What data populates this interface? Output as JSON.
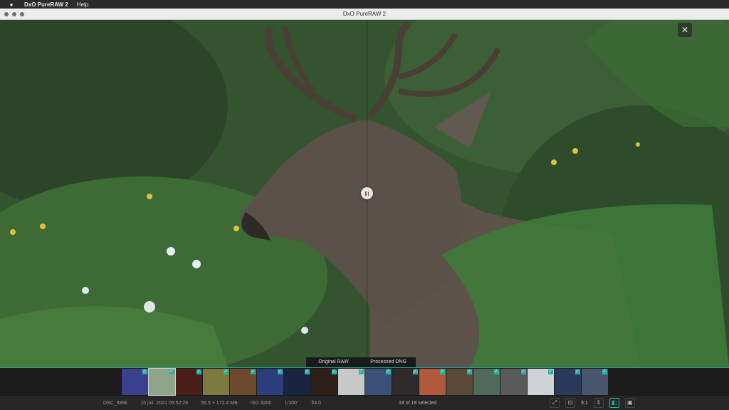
{
  "menubar": {
    "app_name": "DxO PureRAW 2",
    "menu_help": "Help"
  },
  "window": {
    "title": "DxO PureRAW 2"
  },
  "viewer": {
    "close_symbol": "✕",
    "compare_left_label": "Original RAW",
    "compare_right_label": "Processed DNG",
    "divider_position": 0.503
  },
  "filmstrip": {
    "thumbnails": [
      {
        "color": "#3b3f8f",
        "checked": true
      },
      {
        "color": "#8fa58a",
        "checked": true,
        "selected": true
      },
      {
        "color": "#4a1f1a",
        "checked": true
      },
      {
        "color": "#7c7a3e",
        "checked": true
      },
      {
        "color": "#6b4a2e",
        "checked": true
      },
      {
        "color": "#2a3f7a",
        "checked": true
      },
      {
        "color": "#1a2340",
        "checked": true
      },
      {
        "color": "#2e2018",
        "checked": true
      },
      {
        "color": "#c7c9c9",
        "checked": true
      },
      {
        "color": "#3a4f7a",
        "checked": true
      },
      {
        "color": "#2f2a2b",
        "checked": true
      },
      {
        "color": "#b05a3a",
        "checked": true
      },
      {
        "color": "#5a4a3a",
        "checked": true
      },
      {
        "color": "#4f6a5a",
        "checked": true
      },
      {
        "color": "#5a5a5a",
        "checked": true
      },
      {
        "color": "#cfd3d8",
        "checked": true
      },
      {
        "color": "#2a3a5a",
        "checked": true
      },
      {
        "color": "#4a5570",
        "checked": true
      }
    ]
  },
  "status": {
    "filename": "DSC_3896",
    "date": "15 juil. 2021 05:52:26",
    "size": "56.5 + 172.4 MB",
    "iso": "ISO 3200",
    "shutter": "1/100\"",
    "aperture": "f/4.0",
    "selection": "18 of 18 selected",
    "zoom": "3:1"
  },
  "colors": {
    "accent": "#2bb3a6"
  }
}
